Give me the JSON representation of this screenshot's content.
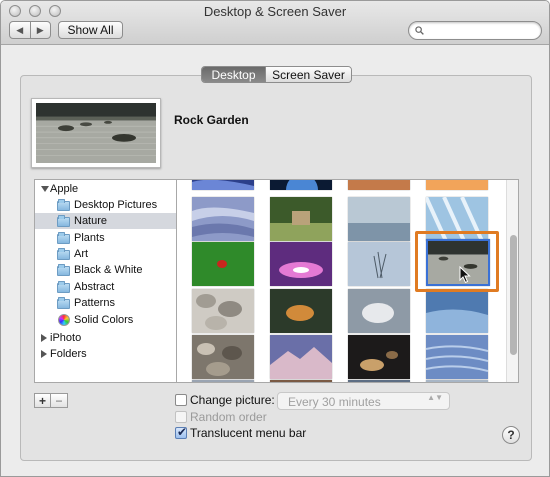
{
  "window": {
    "title": "Desktop & Screen Saver"
  },
  "toolbar": {
    "back_icon": "chevron-left-icon",
    "forward_icon": "chevron-right-icon",
    "back_glyph": "◀",
    "forward_glyph": "▶",
    "show_all_label": "Show All",
    "search_placeholder": "",
    "search_icon": "magnifier-icon"
  },
  "tabs": [
    {
      "label": "Desktop",
      "selected": true
    },
    {
      "label": "Screen Saver",
      "selected": false
    }
  ],
  "preview": {
    "name": "Rock Garden"
  },
  "source_list": {
    "groups": [
      {
        "label": "Apple",
        "expanded": true
      },
      {
        "label": "iPhoto",
        "expanded": false
      },
      {
        "label": "Folders",
        "expanded": false
      }
    ],
    "apple_items": [
      {
        "label": "Desktop Pictures",
        "icon": "folder-icon"
      },
      {
        "label": "Nature",
        "icon": "folder-icon",
        "selected": true
      },
      {
        "label": "Plants",
        "icon": "folder-icon"
      },
      {
        "label": "Art",
        "icon": "folder-icon"
      },
      {
        "label": "Black & White",
        "icon": "folder-icon"
      },
      {
        "label": "Abstract",
        "icon": "folder-icon"
      },
      {
        "label": "Patterns",
        "icon": "folder-icon"
      },
      {
        "label": "Solid Colors",
        "icon": "color-wheel-icon"
      }
    ]
  },
  "grid": {
    "columns": 4,
    "selected_thumbnail": "Rock Garden",
    "thumbnails_icon": "wallpaper-thumbnail"
  },
  "controls": {
    "add_label": "+",
    "remove_label": "−",
    "change_picture_label": "Change picture:",
    "change_picture_checked": false,
    "interval_value": "Every 30 minutes",
    "interval_arrows": "▲▼",
    "random_order_label": "Random order",
    "random_order_checked": false,
    "translucent_label": "Translucent menu bar",
    "translucent_checked": true,
    "help_label": "?"
  },
  "colors": {
    "selection_blue": "#3a71d6",
    "annotation_orange": "#e07b22"
  }
}
